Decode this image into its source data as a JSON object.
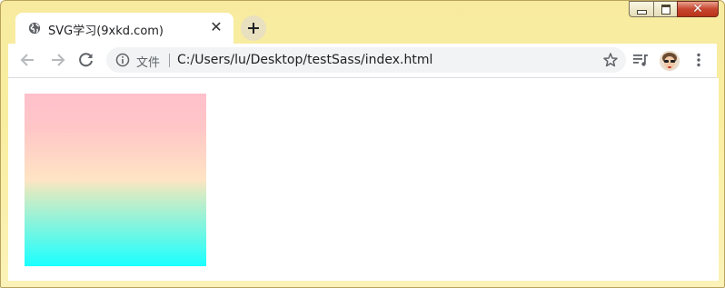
{
  "window": {
    "caption_buttons": {
      "minimize": "minimize",
      "maximize": "maximize",
      "close": "close"
    }
  },
  "tab": {
    "title": "SVG学习(9xkd.com)",
    "close_glyph": "✕",
    "favicon": "globe-icon"
  },
  "new_tab": {
    "icon": "plus-icon"
  },
  "toolbar": {
    "back_icon": "arrow-left-icon",
    "forward_icon": "arrow-right-icon",
    "reload_icon": "reload-icon",
    "omnibox": {
      "info_icon": "info-icon",
      "scheme_label": "文件",
      "url": "C:/Users/lu/Desktop/testSass/index.html",
      "bookmark_icon": "star-icon"
    },
    "media_icon": "playlist-icon",
    "avatar": "profile-avatar",
    "menu_icon": "kebab-menu-icon"
  },
  "content": {
    "gradient_rect": {
      "stops": [
        {
          "offset": "0%",
          "color": "#ffc0cb"
        },
        {
          "offset": "20%",
          "color": "#ffc6c7"
        },
        {
          "offset": "50%",
          "color": "#ffe4c4"
        },
        {
          "offset": "58%",
          "color": "#d4ecc4"
        },
        {
          "offset": "100%",
          "color": "#1affff"
        }
      ]
    }
  },
  "colors": {
    "frame": "#f8eba0",
    "toolbar_bg": "#ffffff",
    "omnibox_bg": "#f1f3f4",
    "text": "#202124",
    "muted_text": "#5f6368"
  }
}
